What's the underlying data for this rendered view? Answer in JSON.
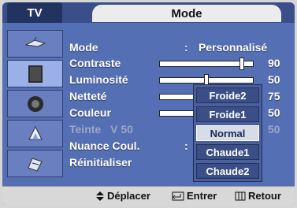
{
  "header": {
    "tv_label": "TV",
    "menu_title": "Mode"
  },
  "sidebar": {
    "items": [
      {
        "icon": "antenna-icon"
      },
      {
        "icon": "picture-icon",
        "active": true
      },
      {
        "icon": "speaker-icon"
      },
      {
        "icon": "channel-icon"
      },
      {
        "icon": "setup-icon"
      }
    ]
  },
  "menu": {
    "mode": {
      "label": "Mode",
      "separator": ":",
      "value": "Personnalisé"
    },
    "contraste": {
      "label": "Contraste",
      "value": "90",
      "level": 0.9
    },
    "luminosite": {
      "label": "Luminosité",
      "value": "50",
      "level": 0.5
    },
    "nettete": {
      "label": "Netteté",
      "value": "75",
      "level": 0.75
    },
    "couleur": {
      "label": "Couleur",
      "value": "50",
      "level": 0.5
    },
    "teinte": {
      "label": "Teinte",
      "sub": "V 50",
      "value": "50",
      "level": 0.5
    },
    "nuance": {
      "label": "Nuance Coul.",
      "separator": ":"
    },
    "reinit": {
      "label": "Réinitialiser"
    }
  },
  "dropdown": {
    "options": [
      "Froide2",
      "Froide1",
      "Normal",
      "Chaude1",
      "Chaude2"
    ],
    "selected": "Normal"
  },
  "footer": {
    "move_label": "Déplacer",
    "enter_label": "Entrer",
    "return_label": "Retour"
  }
}
